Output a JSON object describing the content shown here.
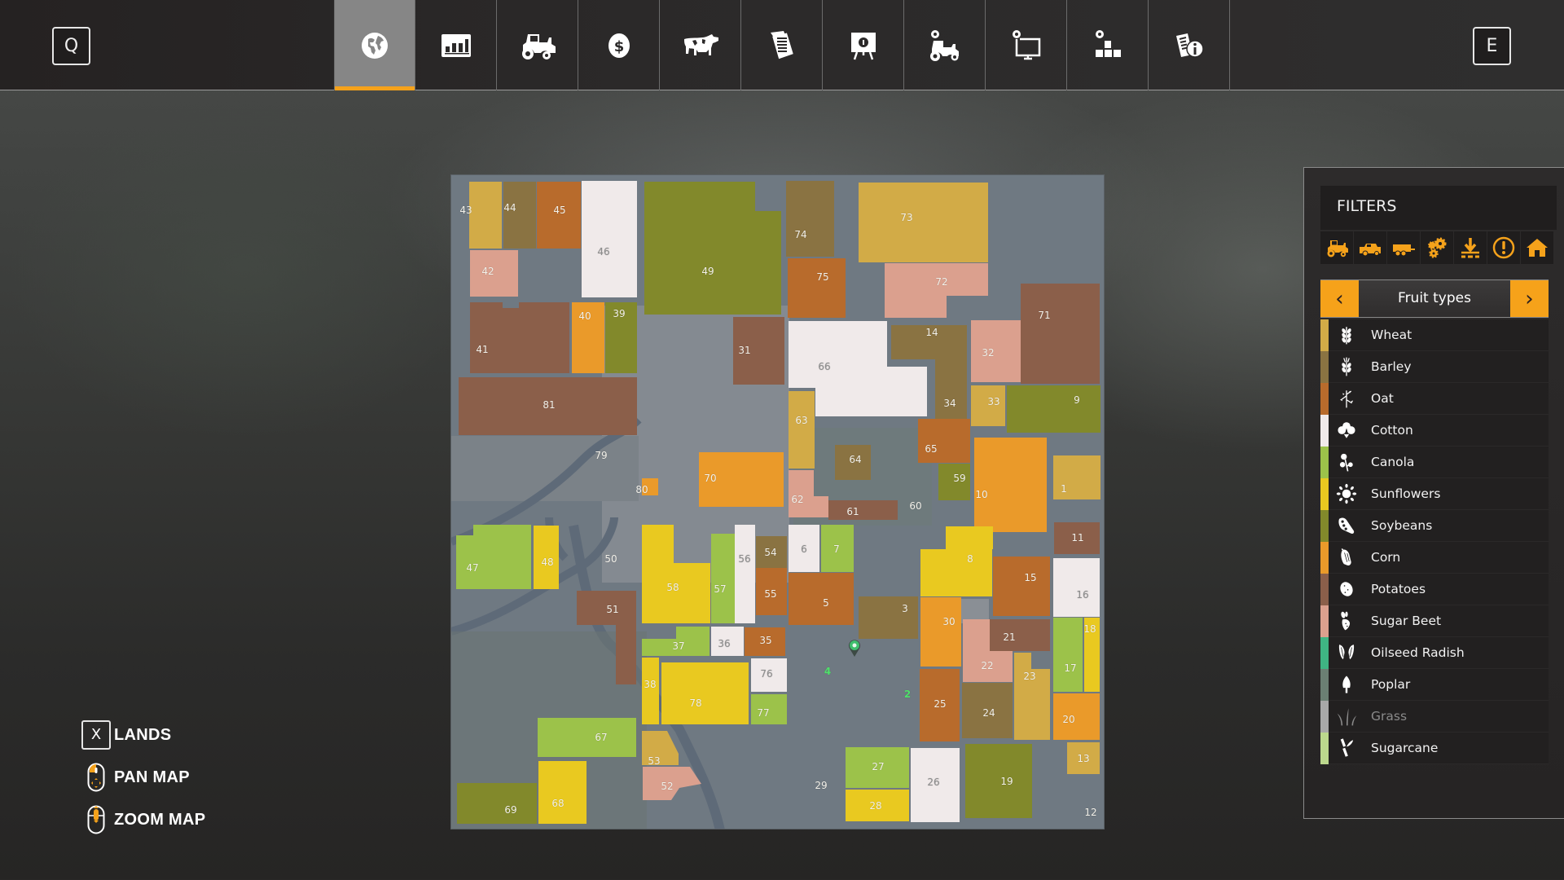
{
  "top_bar": {
    "left_key": "Q",
    "right_key": "E",
    "tabs": [
      {
        "id": "map",
        "icon": "globe-icon",
        "active": true
      },
      {
        "id": "statistics",
        "icon": "bar-chart-icon",
        "active": false
      },
      {
        "id": "vehicles",
        "icon": "tractor-icon",
        "active": false
      },
      {
        "id": "finances",
        "icon": "dollar-coin-icon",
        "active": false
      },
      {
        "id": "animals",
        "icon": "cow-icon",
        "active": false
      },
      {
        "id": "contracts",
        "icon": "documents-icon",
        "active": false
      },
      {
        "id": "help-guide",
        "icon": "presentation-board-icon",
        "active": false
      },
      {
        "id": "garage-settings",
        "icon": "tractor-gear-icon",
        "active": false
      },
      {
        "id": "general-settings",
        "icon": "monitor-gear-icon",
        "active": false
      },
      {
        "id": "game-settings",
        "icon": "blocks-gear-icon",
        "active": false
      },
      {
        "id": "help-info",
        "icon": "document-info-icon",
        "active": false
      }
    ],
    "accent_color": "#f5a21b"
  },
  "map": {
    "fields": [
      {
        "id": "43",
        "crop": "wheat"
      },
      {
        "id": "44",
        "crop": "barley"
      },
      {
        "id": "45",
        "crop": "oat"
      },
      {
        "id": "46",
        "crop": "cotton"
      },
      {
        "id": "42",
        "crop": "sugar_beet"
      },
      {
        "id": "41",
        "crop": "potatoes"
      },
      {
        "id": "40",
        "crop": "corn"
      },
      {
        "id": "39",
        "crop": "soybeans"
      },
      {
        "id": "81",
        "crop": "potatoes"
      },
      {
        "id": "49",
        "crop": "soybeans"
      },
      {
        "id": "31",
        "crop": "potatoes"
      },
      {
        "id": "80",
        "crop": "corn"
      },
      {
        "id": "70",
        "crop": "corn"
      },
      {
        "id": "74",
        "crop": "barley"
      },
      {
        "id": "75",
        "crop": "oat"
      },
      {
        "id": "73",
        "crop": "wheat"
      },
      {
        "id": "72",
        "crop": "sugar_beet"
      },
      {
        "id": "71",
        "crop": "potatoes"
      },
      {
        "id": "66",
        "crop": "cotton"
      },
      {
        "id": "14",
        "crop": "barley"
      },
      {
        "id": "34",
        "crop": "barley"
      },
      {
        "id": "32",
        "crop": "sugar_beet"
      },
      {
        "id": "33",
        "crop": "wheat"
      },
      {
        "id": "9",
        "crop": "soybeans"
      },
      {
        "id": "63",
        "crop": "wheat"
      },
      {
        "id": "62",
        "crop": "sugar_beet"
      },
      {
        "id": "64",
        "crop": "barley"
      },
      {
        "id": "65",
        "crop": "oat"
      },
      {
        "id": "59",
        "crop": "soybeans"
      },
      {
        "id": "10",
        "crop": "corn"
      },
      {
        "id": "1",
        "crop": "wheat"
      },
      {
        "id": "61",
        "crop": "potatoes"
      },
      {
        "id": "47",
        "crop": "canola"
      },
      {
        "id": "48",
        "crop": "sunflowers"
      },
      {
        "id": "51",
        "crop": "potatoes"
      },
      {
        "id": "58",
        "crop": "sunflowers"
      },
      {
        "id": "57",
        "crop": "canola"
      },
      {
        "id": "56",
        "crop": "cotton"
      },
      {
        "id": "54",
        "crop": "barley"
      },
      {
        "id": "55",
        "crop": "oat"
      },
      {
        "id": "37",
        "crop": "canola"
      },
      {
        "id": "36",
        "crop": "cotton"
      },
      {
        "id": "35",
        "crop": "oat"
      },
      {
        "id": "38",
        "crop": "sunflowers"
      },
      {
        "id": "78",
        "crop": "sunflowers"
      },
      {
        "id": "76",
        "crop": "cotton"
      },
      {
        "id": "77",
        "crop": "canola"
      },
      {
        "id": "67",
        "crop": "canola"
      },
      {
        "id": "53",
        "crop": "wheat"
      },
      {
        "id": "52",
        "crop": "sugar_beet"
      },
      {
        "id": "69",
        "crop": "soybeans"
      },
      {
        "id": "68",
        "crop": "sunflowers"
      },
      {
        "id": "6",
        "crop": "cotton"
      },
      {
        "id": "7",
        "crop": "canola"
      },
      {
        "id": "5",
        "crop": "oat"
      },
      {
        "id": "3",
        "crop": "barley"
      },
      {
        "id": "8",
        "crop": "sunflowers"
      },
      {
        "id": "30",
        "crop": "corn"
      },
      {
        "id": "15",
        "crop": "oat"
      },
      {
        "id": "11",
        "crop": "potatoes"
      },
      {
        "id": "16",
        "crop": "cotton"
      },
      {
        "id": "22",
        "crop": "sugar_beet"
      },
      {
        "id": "21",
        "crop": "potatoes"
      },
      {
        "id": "23",
        "crop": "wheat"
      },
      {
        "id": "17",
        "crop": "canola"
      },
      {
        "id": "18",
        "crop": "sunflowers"
      },
      {
        "id": "20",
        "crop": "corn"
      },
      {
        "id": "25",
        "crop": "oat"
      },
      {
        "id": "24",
        "crop": "barley"
      },
      {
        "id": "13",
        "crop": "wheat"
      },
      {
        "id": "27",
        "crop": "canola"
      },
      {
        "id": "28",
        "crop": "sunflowers"
      },
      {
        "id": "26",
        "crop": "cotton"
      },
      {
        "id": "19",
        "crop": "soybeans"
      }
    ],
    "unplanted_fields": [
      "79",
      "50",
      "60",
      "29",
      "12"
    ],
    "owned_fields": [
      "4",
      "2"
    ]
  },
  "help": {
    "lands_key": "X",
    "lands_label": "LANDS",
    "pan_label": "PAN MAP",
    "zoom_label": "ZOOM MAP"
  },
  "filters": {
    "title": "FILTERS",
    "icons": [
      "tractor-icon",
      "harvester-icon",
      "trailer-icon",
      "gears-icon",
      "download-icon",
      "alert-icon",
      "home-icon"
    ],
    "selector": {
      "label": "Fruit types",
      "prev": "‹",
      "next": "›"
    },
    "legend": [
      {
        "key": "wheat",
        "name": "Wheat",
        "color": "#d2ab47",
        "icon": "wheat-icon",
        "enabled": true
      },
      {
        "key": "barley",
        "name": "Barley",
        "color": "#8a7342",
        "icon": "barley-icon",
        "enabled": true
      },
      {
        "key": "oat",
        "name": "Oat",
        "color": "#b86b2c",
        "icon": "oat-icon",
        "enabled": true
      },
      {
        "key": "cotton",
        "name": "Cotton",
        "color": "#f0eaea",
        "icon": "cotton-icon",
        "enabled": true
      },
      {
        "key": "canola",
        "name": "Canola",
        "color": "#9cc24a",
        "icon": "canola-icon",
        "enabled": true
      },
      {
        "key": "sunflowers",
        "name": "Sunflowers",
        "color": "#e9c920",
        "icon": "sunflower-icon",
        "enabled": true
      },
      {
        "key": "soybeans",
        "name": "Soybeans",
        "color": "#82892b",
        "icon": "soybean-icon",
        "enabled": true
      },
      {
        "key": "corn",
        "name": "Corn",
        "color": "#ea9a2a",
        "icon": "corn-icon",
        "enabled": true
      },
      {
        "key": "potatoes",
        "name": "Potatoes",
        "color": "#8b5f4a",
        "icon": "potato-icon",
        "enabled": true
      },
      {
        "key": "sugar_beet",
        "name": "Sugar Beet",
        "color": "#dba08e",
        "icon": "sugar-beet-icon",
        "enabled": true
      },
      {
        "key": "oilseed_radish",
        "name": "Oilseed Radish",
        "color": "#3fb483",
        "icon": "oilseed-radish-icon",
        "enabled": true
      },
      {
        "key": "poplar",
        "name": "Poplar",
        "color": "#6b7f73",
        "icon": "poplar-icon",
        "enabled": true
      },
      {
        "key": "grass",
        "name": "Grass",
        "color": "#a8a8a8",
        "icon": "grass-icon",
        "enabled": false
      },
      {
        "key": "sugarcane",
        "name": "Sugarcane",
        "color": "#bcd88d",
        "icon": "sugarcane-icon",
        "enabled": true
      }
    ]
  }
}
